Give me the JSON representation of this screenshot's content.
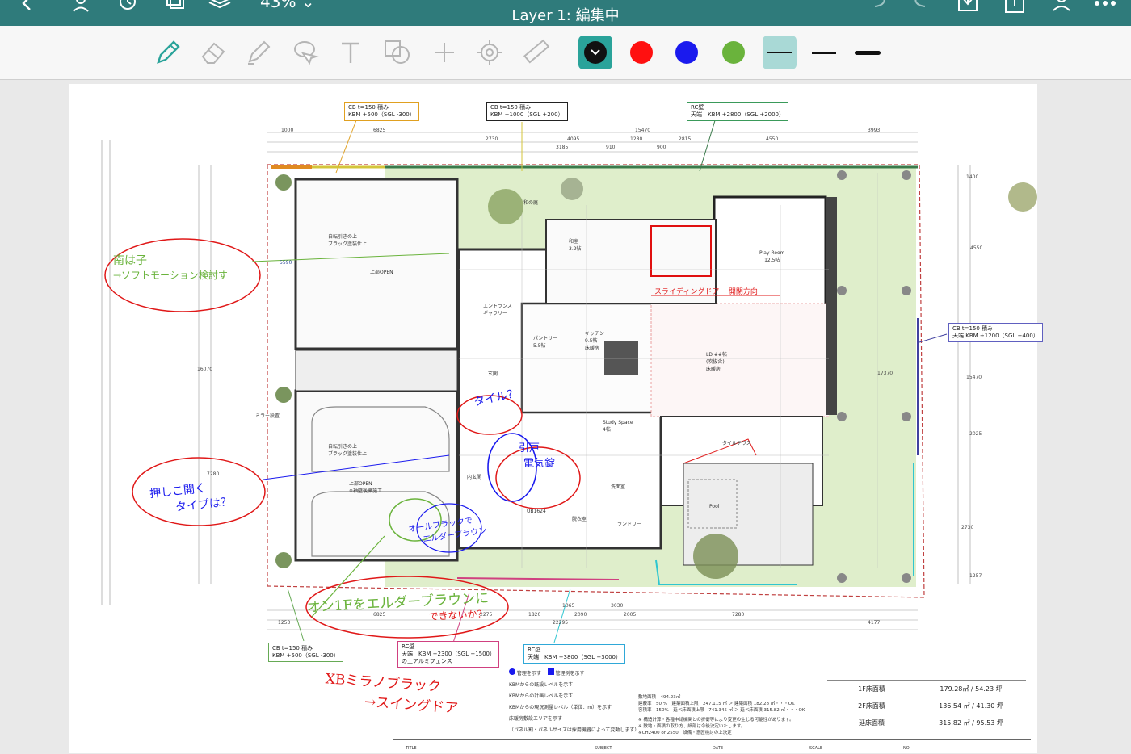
{
  "app": {
    "title": "Layer 1: 編集中",
    "zoom": "43%"
  },
  "colors": {
    "appbar": "#2f7b7b",
    "accent": "#2aa39a",
    "pen_black": "#111111",
    "pen_red": "#ff1010",
    "pen_blue": "#1a1aee",
    "pen_green": "#6ab33c",
    "selected_bg": "#a9d9d6"
  },
  "topbar_icons": [
    "back-icon",
    "user-settings-icon",
    "history-icon",
    "pages-icon",
    "layers-icon",
    "undo-icon",
    "redo-icon",
    "download-icon",
    "share-icon",
    "people-icon",
    "more-icon"
  ],
  "tools": [
    "pen-icon",
    "eraser-icon",
    "highlighter-icon",
    "lasso-icon",
    "text-icon",
    "shape-icon",
    "plus-icon",
    "laser-pointer-icon",
    "ruler-icon"
  ],
  "pen_colors": [
    "black",
    "red",
    "blue",
    "green"
  ],
  "stroke_widths": [
    "thin",
    "medium",
    "thick"
  ],
  "plan": {
    "callouts": {
      "cb150_left_top": [
        "CB t=150 積み",
        "KBM +500（SGL -300）"
      ],
      "cb150_center_top": [
        "CB t=150 積み",
        "KBM +1000（SGL +200）"
      ],
      "rc_wall_top": [
        "RC壁",
        "天端　KBM +2800（SGL +2000）"
      ],
      "cb150_right": [
        "CB t=150 積み",
        "天端 KBM +1200（SGL +400）"
      ],
      "cb150_bottom_left": [
        "CB t=150 積み",
        "KBM +500（SGL -300）"
      ],
      "rc_wall_bottom_mid": [
        "RC壁",
        "天端　KBM +2300（SGL +1500）",
        "の上アルミフェンス"
      ],
      "rc_wall_bottom_right": [
        "RC壁",
        "天端　KBM +3800（SGL +3000）"
      ]
    },
    "dimensions_top": [
      "1000",
      "6825",
      "15470",
      "3993",
      "2730",
      "4095",
      "1280",
      "2815",
      "4550",
      "3185",
      "910",
      "900"
    ],
    "dimensions_bottom": [
      "1253",
      "6825",
      "2275",
      "1820",
      "2090",
      "2005",
      "7280",
      "4177",
      "1065",
      "3030",
      "22295"
    ],
    "dimensions_left": [
      "5590",
      "16070",
      "7280"
    ],
    "dimensions_right": [
      "1400",
      "4550",
      "17370",
      "15470",
      "2025",
      "2730",
      "1257"
    ],
    "rooms": {
      "play_room": [
        "Play Room",
        "12.5帖"
      ],
      "entrance": [
        "エントランス",
        "ギャラリー"
      ],
      "pantry": [
        "パントリー",
        "5.5帖"
      ],
      "kitchen": [
        "キッチン",
        "9.5帖",
        "床暖房"
      ],
      "ld": [
        "LD ##帖",
        "(吹抜含)",
        "床暖房"
      ],
      "genkan": "玄関",
      "study": [
        "Study Space",
        "4帖"
      ],
      "tile_terrace": "タイルテラス",
      "pool": "Pool",
      "laundry": "ランドリー",
      "dressing": "脱衣室",
      "washroom": "洗面室",
      "washitsu": [
        "和室",
        "3.2帖"
      ],
      "wa_garden": "和の庭",
      "garage_note_1": [
        "自転引きの上",
        "ブラック塗装仕上"
      ],
      "garage_note_2": [
        "自転引きの上",
        "ブラック塗装仕上"
      ],
      "upper_open_1": "上部OPEN",
      "upper_open_2": [
        "上部OPEN",
        "※袖壁後擁施工"
      ],
      "sub_entrance": "内玄関",
      "ub": [
        "UB1624"
      ],
      "mirror_rack": "ミラー設置"
    },
    "legend": [
      "管理を示す",
      "管理例を示す",
      "KBMからの既設レベルを示す",
      "KBMからの計画レベルを示す",
      "KBMからの現況測量レベル（単位：m）を示す",
      "床暖房敷設エリアを示す",
      "（パネル割・パネルサイズは採用機器によって変動します）"
    ],
    "notes": [
      "敷地面積　494.23㎡",
      "建蔽率　50 %　建築面積上限　247.115 ㎡ ＞ 建築面積 182.28 ㎡・・・OK",
      "容積率　150%　延べ床面積上限　741.345 ㎡ ＞ 延べ床面積 315.82 ㎡・・・OK",
      "※ 構造計算・各種申請機関との折衝等により変更の生じる可能性があります。",
      "※ 敷地・面積の取り方、細部は今後決定いたします。",
      "※CH2400 or 2550　設備・意匠検討の上決定"
    ],
    "area_table": [
      {
        "label": "1F床面積",
        "value": "179.28㎡ / 54.23 坪"
      },
      {
        "label": "2F床面積",
        "value": "136.54 ㎡ / 41.30 坪"
      },
      {
        "label": "延床面積",
        "value": "315.82 ㎡ / 95.53 坪"
      }
    ],
    "titleblock": [
      "TITLE",
      "SUBJECT",
      "DATE",
      "SCALE",
      "NO."
    ]
  },
  "annotations": {
    "green_left": [
      "南は子",
      "→ソフトモーション検討す"
    ],
    "blue_left": [
      "押しこ開く",
      "タイプは？"
    ],
    "green_bottom": [
      "オン1Fをエルダーブラウンに",
      "できないか？"
    ],
    "red_bottom_left": [
      "XBミラノブラック",
      "→スイングドア"
    ],
    "blue_genkan": [
      "タイル？",
      "電気錠？"
    ],
    "blue_door": [
      "引戸",
      "電気錠"
    ],
    "green_garage": [
      "オールブラックで",
      "エルダーブラウン"
    ],
    "red_kitchen_note": [
      "スライディングドア",
      "開閉方向"
    ]
  }
}
